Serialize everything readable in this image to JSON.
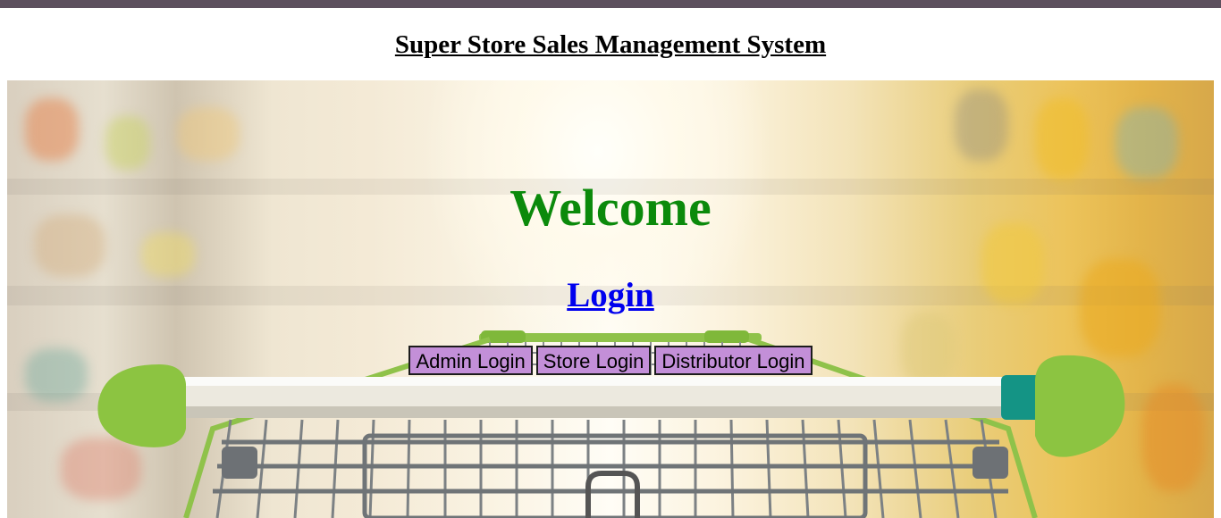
{
  "header": {
    "title": "Super Store Sales Management System"
  },
  "hero": {
    "welcome": "Welcome",
    "login_link": "Login",
    "buttons": [
      {
        "label": "Admin Login"
      },
      {
        "label": "Store Login"
      },
      {
        "label": "Distributor Login"
      }
    ]
  },
  "colors": {
    "top_bar": "#5d505e",
    "welcome_text": "#0b8a0b",
    "link": "#0000ee",
    "button_bg": "#c38fd8"
  }
}
